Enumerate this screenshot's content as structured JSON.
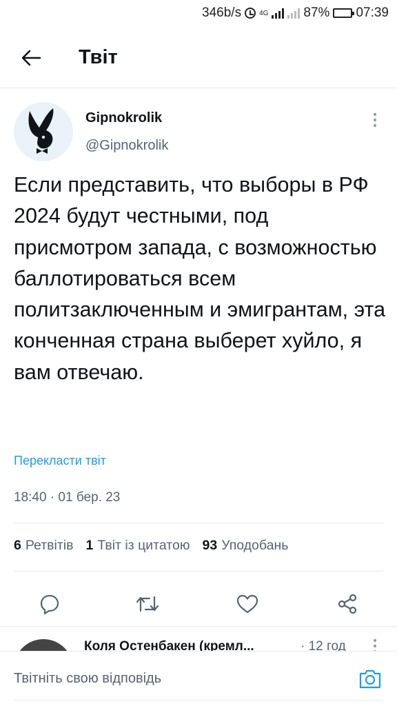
{
  "status_bar": {
    "speed": "346b/s",
    "network": "4G",
    "battery": "87%",
    "time": "07:39"
  },
  "header": {
    "title": "Твіт"
  },
  "tweet": {
    "author_name": "Gipnokrolik",
    "author_handle": "@Gipnokrolik",
    "text": "Если представить, что выборы в РФ 2024 будут честными, под присмотром запада, с возможностью баллотироваться всем политзаключенным и эмигрантам, эта конченная страна выберет хуйло, я вам отвечаю.",
    "translate_label": "Перекласти твіт",
    "timestamp": "18:40 · 01 бер. 23",
    "stats": {
      "retweets_count": "6",
      "retweets_label": "Ретвітів",
      "quotes_count": "1",
      "quotes_label": "Твіт із цитатою",
      "likes_count": "93",
      "likes_label": "Уподобань"
    }
  },
  "reply_preview": {
    "name": "Коля Остенбакен (кремл...",
    "time": "· 12 год"
  },
  "compose": {
    "placeholder": "Твітніть свою відповідь"
  },
  "colors": {
    "accent": "#1d9bf0",
    "text": "#0f1419",
    "secondary": "#536471"
  }
}
